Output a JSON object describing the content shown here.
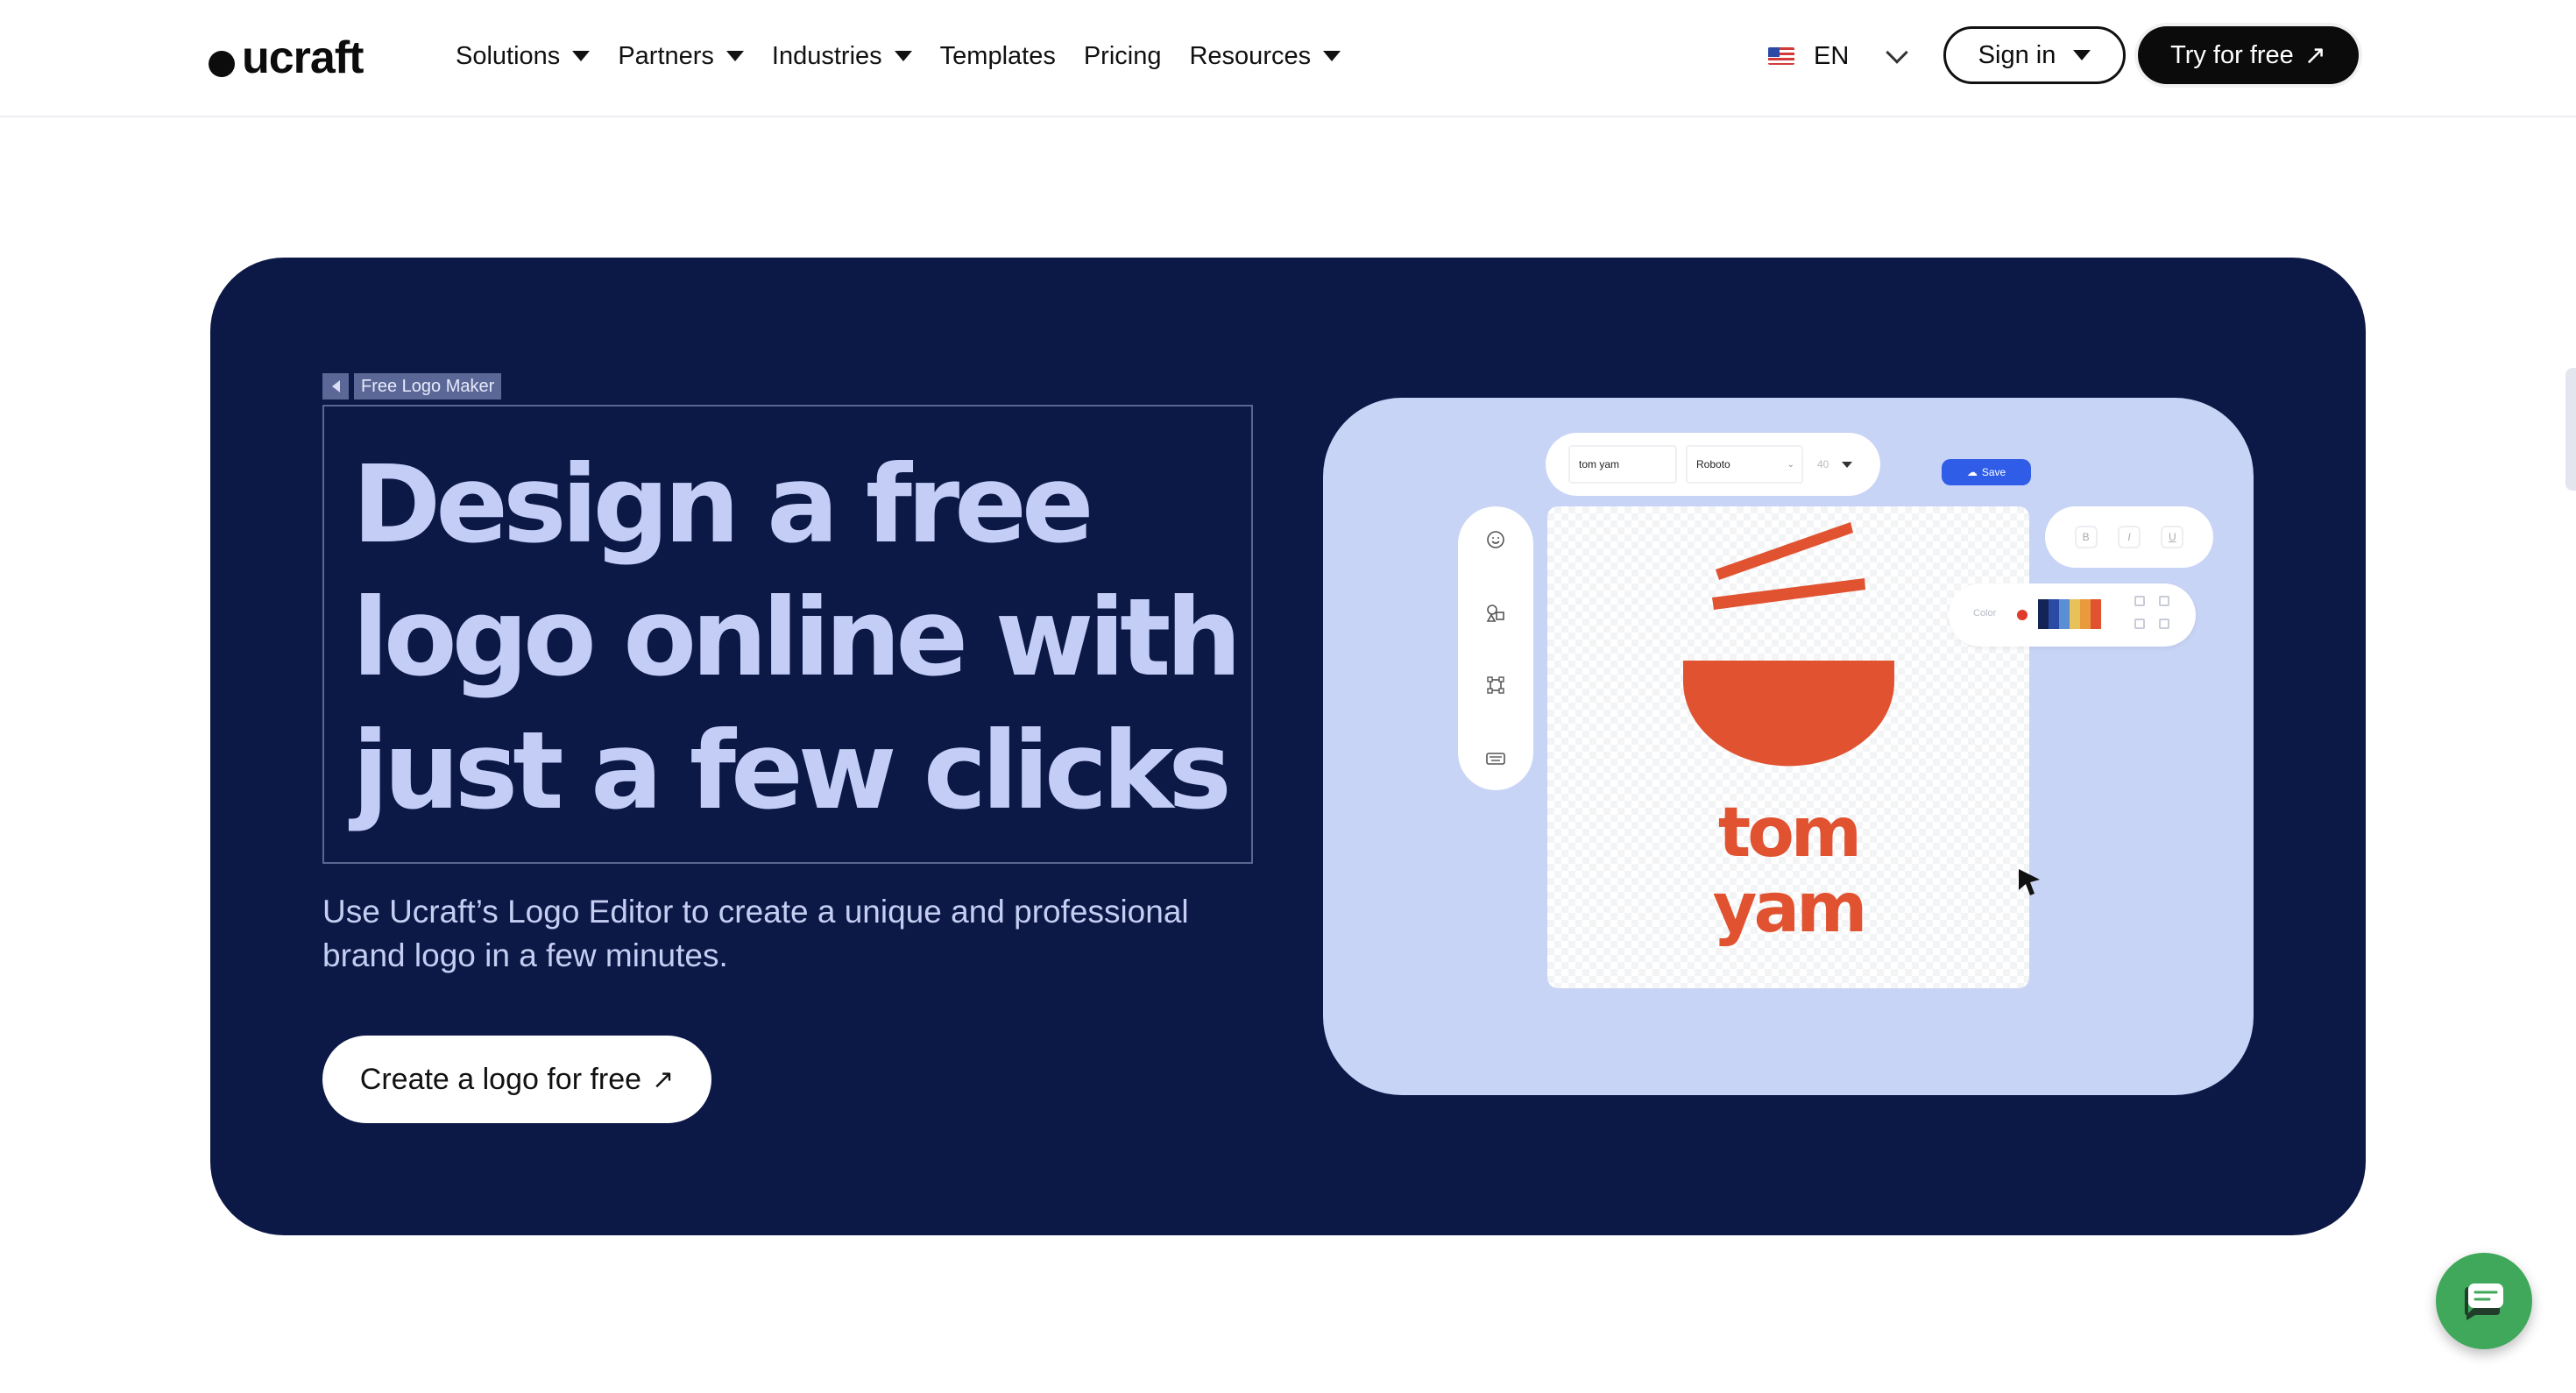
{
  "brand": {
    "name": "ucraft"
  },
  "nav": {
    "items": [
      {
        "label": "Solutions",
        "has_dropdown": true
      },
      {
        "label": "Partners",
        "has_dropdown": true
      },
      {
        "label": "Industries",
        "has_dropdown": true
      },
      {
        "label": "Templates",
        "has_dropdown": false
      },
      {
        "label": "Pricing",
        "has_dropdown": false
      },
      {
        "label": "Resources",
        "has_dropdown": true
      }
    ],
    "language": "EN",
    "flag_icon": "us-flag-icon",
    "sign_in": "Sign in",
    "try_free": "Try for free"
  },
  "hero": {
    "badge": "Free Logo Maker",
    "title": "Design a free logo online with just a few clicks",
    "subtitle": "Use Ucraft’s Logo Editor to create a unique and professional brand logo in a few minutes.",
    "cta": "Create a logo for free",
    "background_color": "#0c1846",
    "title_color": "#c3cdf6"
  },
  "editor": {
    "name_field": "tom yam",
    "font_select": "Roboto",
    "size_field": "40",
    "save": "Save",
    "format_buttons": [
      "B",
      "I",
      "U"
    ],
    "color_label": "Color",
    "palette": [
      "#152457",
      "#2b4aa6",
      "#5a8fd6",
      "#e9c15a",
      "#e89a3c",
      "#e05230"
    ],
    "tool_icons": [
      "smiley-icon",
      "shapes-icon",
      "frame-icon",
      "keyboard-icon"
    ],
    "logo_line1": "tom",
    "logo_line2": "yam",
    "logo_color": "#e05230",
    "panel_color": "#c8d4f6"
  },
  "chat": {
    "icon": "chat-bubble-icon",
    "color": "#3fa85a"
  }
}
